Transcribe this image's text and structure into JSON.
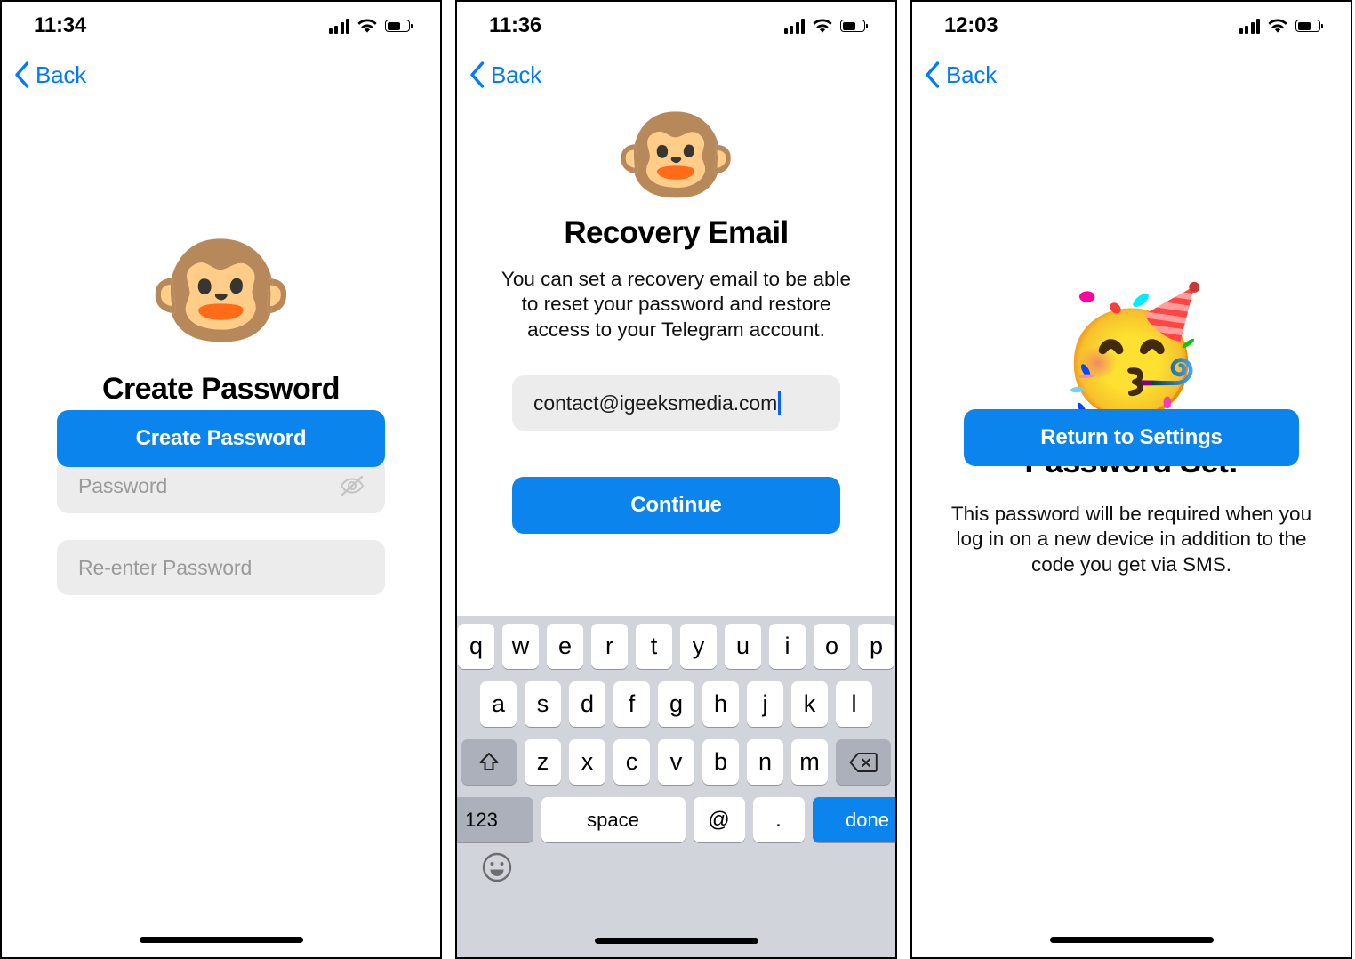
{
  "panels": [
    {
      "status": {
        "time": "11:34",
        "signal_icon": "cellular-bars-icon",
        "wifi_icon": "wifi-icon",
        "battery_icon": "battery-icon"
      },
      "nav": {
        "back_label": "Back",
        "back_icon": "chevron-left-icon"
      },
      "hero_emoji": "🐵",
      "hero_emoji_name": "monkey-face-emoji",
      "title": "Create Password",
      "fields": [
        {
          "placeholder": "Password",
          "value": "",
          "trailing_icon": "eye-off-icon"
        },
        {
          "placeholder": "Re-enter Password",
          "value": "",
          "trailing_icon": ""
        }
      ],
      "primary_button": "Create Password"
    },
    {
      "status": {
        "time": "11:36",
        "signal_icon": "cellular-bars-icon",
        "wifi_icon": "wifi-icon",
        "battery_icon": "battery-icon"
      },
      "nav": {
        "back_label": "Back",
        "back_icon": "chevron-left-icon"
      },
      "hero_emoji": "🐵",
      "hero_emoji_name": "monkey-face-emoji",
      "title": "Recovery Email",
      "subtitle": "You can set a recovery email to be able to reset your password and restore access to your Telegram account.",
      "email_field": {
        "value": "contact@igeeksmedia.com",
        "placeholder": "",
        "caret": true
      },
      "primary_button": "Continue",
      "keyboard": {
        "row1": [
          "q",
          "w",
          "e",
          "r",
          "t",
          "y",
          "u",
          "i",
          "o",
          "p"
        ],
        "row2": [
          "a",
          "s",
          "d",
          "f",
          "g",
          "h",
          "j",
          "k",
          "l"
        ],
        "row3_shift": "shift-icon",
        "row3": [
          "z",
          "x",
          "c",
          "v",
          "b",
          "n",
          "m"
        ],
        "row3_delete": "delete-icon",
        "row4": [
          "123",
          "space",
          "@",
          ".",
          "done"
        ],
        "emoji_key": "emoji-smiley-icon"
      }
    },
    {
      "status": {
        "time": "12:03",
        "signal_icon": "cellular-bars-icon",
        "wifi_icon": "wifi-icon",
        "battery_icon": "battery-icon"
      },
      "nav": {
        "back_label": "Back",
        "back_icon": "chevron-left-icon"
      },
      "hero_emoji": "🥳",
      "hero_emoji_name": "partying-face-emoji",
      "title": "Password Set!",
      "subtitle": "This password will be required when you log in on a new device in addition to the code you get via SMS.",
      "primary_button": "Return to Settings"
    }
  ],
  "colors": {
    "accent_blue": "#0C84EE",
    "link_blue": "#007AFF",
    "field_gray": "#ECECEC",
    "keyboard_gray": "#D1D5DB",
    "key_modifier_gray": "#ABB0BA",
    "placeholder_gray": "#9A9A9A",
    "caret_blue": "#0A60FF"
  }
}
